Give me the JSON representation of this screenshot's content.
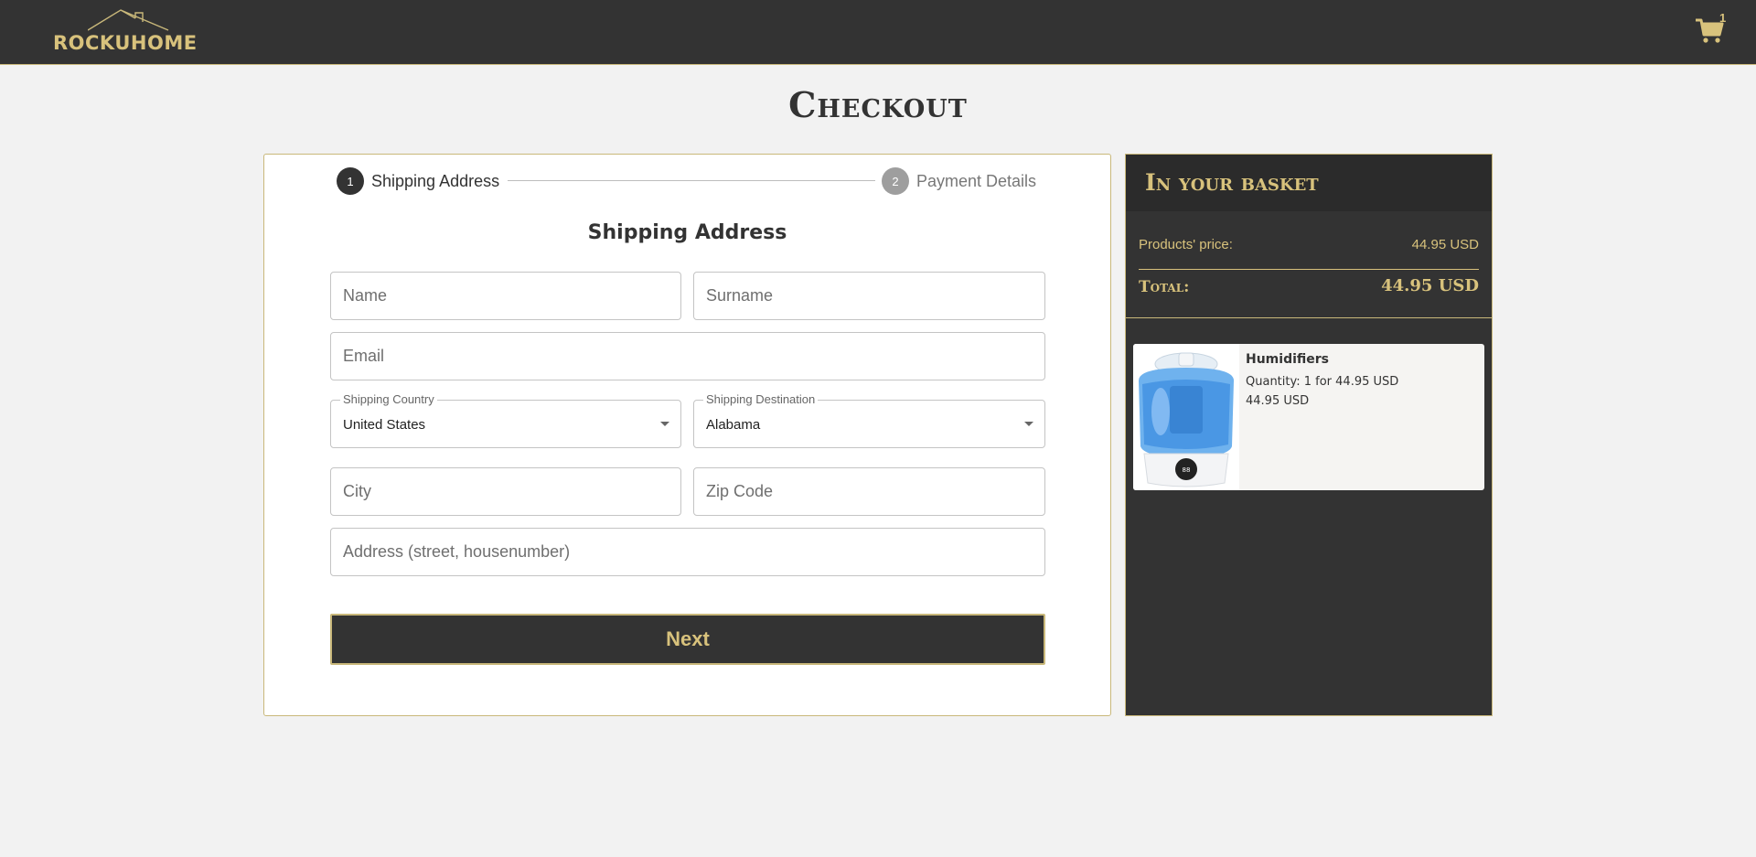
{
  "header": {
    "logo_text": "ROCKUHOME",
    "cart_count": "1"
  },
  "page": {
    "title": "Checkout"
  },
  "stepper": {
    "steps": [
      {
        "number": "1",
        "label": "Shipping Address",
        "active": true
      },
      {
        "number": "2",
        "label": "Payment Details",
        "active": false
      }
    ]
  },
  "form": {
    "title": "Shipping Address",
    "fields": {
      "name": {
        "placeholder": "Name",
        "value": ""
      },
      "surname": {
        "placeholder": "Surname",
        "value": ""
      },
      "email": {
        "placeholder": "Email",
        "value": ""
      },
      "city": {
        "placeholder": "City",
        "value": ""
      },
      "zip": {
        "placeholder": "Zip Code",
        "value": ""
      },
      "address": {
        "placeholder": "Address (street, housenumber)",
        "value": ""
      }
    },
    "country": {
      "label": "Shipping Country",
      "value": "United States"
    },
    "destination": {
      "label": "Shipping Destination",
      "value": "Alabama"
    },
    "next_label": "Next"
  },
  "basket": {
    "title": "In your basket",
    "products_price_label": "Products' price:",
    "products_price_value": "44.95 USD",
    "total_label": "Total:",
    "total_value": "44.95 USD",
    "items": [
      {
        "name": "Humidifiers",
        "quantity_text": "Quantity: 1 for 44.95 USD",
        "price": "44.95 USD",
        "image": "humidifier-product-image"
      }
    ]
  },
  "colors": {
    "accent_gold": "#d8c27c",
    "dark": "#333333",
    "background": "#f2f2f2"
  },
  "icons": [
    "house-roof-icon",
    "shopping-cart-icon",
    "dropdown-caret-icon"
  ]
}
